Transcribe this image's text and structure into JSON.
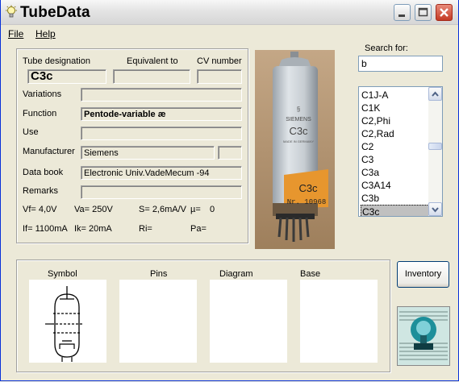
{
  "window": {
    "title": "TubeData"
  },
  "menu": {
    "file": "File",
    "help": "Help"
  },
  "info": {
    "tube_designation_label": "Tube designation",
    "equivalent_label": "Equivalent to",
    "cv_label": "CV number",
    "tube_designation": "C3c",
    "variations_label": "Variations",
    "function_label": "Function",
    "function": "Pentode-variable æ",
    "use_label": "Use",
    "manufacturer_label": "Manufacturer",
    "manufacturer": "Siemens",
    "databook_label": "Data book",
    "databook": "Electronic Univ.VadeMecum -94",
    "remarks_label": "Remarks"
  },
  "params": {
    "vf": "Vf= 4,0V",
    "va": "Va= 250V",
    "s": "S= 2,6mA/V",
    "mu": "µ=",
    "mu_val": "0",
    "if": "If= 1100mA",
    "ik": "Ik= 20mA",
    "ri": "Ri=",
    "pa": "Pa="
  },
  "photo": {
    "brand": "SIEMENS",
    "model": "C3c",
    "made_in": "MADE IN GERMANY",
    "label_model": "C3c",
    "label_nr": "Nr. 10968"
  },
  "search": {
    "label": "Search for:",
    "value": "b"
  },
  "tube_list": [
    "C1J-A",
    "C1K",
    "C2,Phi",
    "C2,Rad",
    "C2",
    "C3",
    "C3a",
    "C3A14",
    "C3b",
    "C3c"
  ],
  "selected_tube": "C3c",
  "panels": {
    "symbol": "Symbol",
    "pins": "Pins",
    "diagram": "Diagram",
    "base": "Base"
  },
  "buttons": {
    "inventory": "Inventory"
  },
  "icons": [
    "bulb-icon",
    "minimize-icon",
    "maximize-icon",
    "close-icon",
    "scroll-up-icon",
    "scroll-down-icon",
    "pentode-symbol-icon",
    "logo-icon"
  ]
}
